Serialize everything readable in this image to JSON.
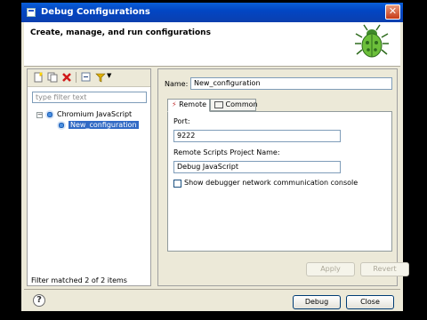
{
  "window": {
    "title": "Debug Configurations"
  },
  "header": {
    "title": "Create, manage, and run configurations"
  },
  "left_panel": {
    "filter_placeholder": "type filter text",
    "tree": {
      "category": "Chromium JavaScript",
      "child": "New_configuration"
    },
    "status": "Filter matched 2 of 2 items"
  },
  "right_panel": {
    "name_label": "Name:",
    "name_value": "New_configuration",
    "tabs": [
      "Remote",
      "Common"
    ],
    "port_label": "Port:",
    "port_value": "9222",
    "project_label": "Remote Scripts Project Name:",
    "project_value": "Debug JavaScript",
    "checkbox_label": "Show debugger network communication console",
    "apply_label": "Apply",
    "revert_label": "Revert"
  },
  "footer": {
    "help": "?",
    "debug_label": "Debug",
    "close_label": "Close"
  },
  "colors": {
    "titlebar": "#0a5fd8",
    "selection": "#316ac5",
    "window_bg": "#ece9d8",
    "close_button": "#c73b18"
  }
}
